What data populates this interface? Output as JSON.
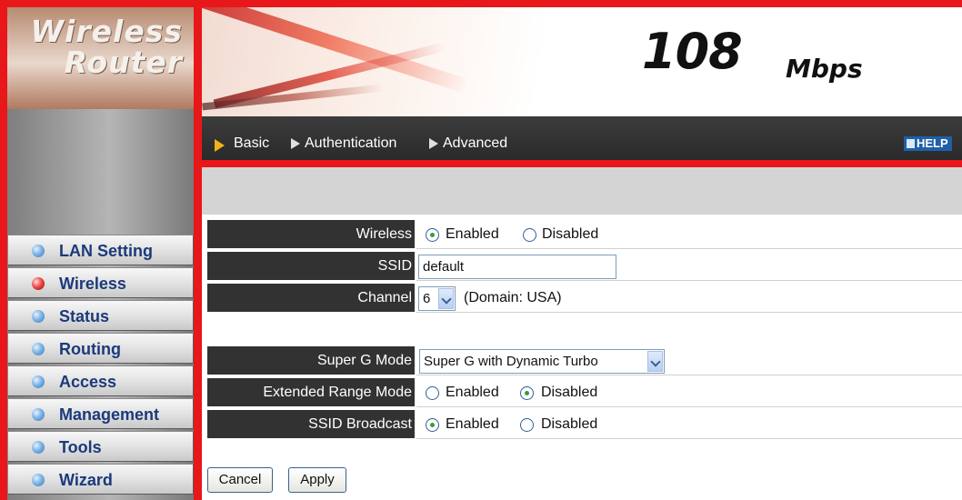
{
  "brand": {
    "logo_line1": "Wireless",
    "logo_line2": "Router",
    "speed_value": "108",
    "speed_unit": "Mbps"
  },
  "nav": {
    "basic": "Basic",
    "authentication": "Authentication",
    "advanced": "Advanced",
    "help": "HELP"
  },
  "sidebar": {
    "items": [
      {
        "label": "LAN Setting",
        "icon": "bullet-blue-icon",
        "active": false
      },
      {
        "label": "Wireless",
        "icon": "bullet-red-icon",
        "active": true
      },
      {
        "label": "Status",
        "icon": "bullet-blue-icon",
        "active": false
      },
      {
        "label": "Routing",
        "icon": "bullet-blue-icon",
        "active": false
      },
      {
        "label": "Access",
        "icon": "bullet-blue-icon",
        "active": false
      },
      {
        "label": "Management",
        "icon": "bullet-blue-icon",
        "active": false
      },
      {
        "label": "Tools",
        "icon": "bullet-blue-icon",
        "active": false
      },
      {
        "label": "Wizard",
        "icon": "bullet-blue-icon",
        "active": false
      }
    ]
  },
  "form": {
    "wireless": {
      "label": "Wireless",
      "opt_enabled": "Enabled",
      "opt_disabled": "Disabled",
      "selected": "Enabled"
    },
    "ssid": {
      "label": "SSID",
      "value": "default"
    },
    "channel": {
      "label": "Channel",
      "value": "6",
      "domain_text": "(Domain: USA)"
    },
    "super_g": {
      "label": "Super G Mode",
      "value": "Super G with Dynamic Turbo"
    },
    "extended_range": {
      "label": "Extended Range Mode",
      "opt_enabled": "Enabled",
      "opt_disabled": "Disabled",
      "selected": "Disabled"
    },
    "ssid_broadcast": {
      "label": "SSID Broadcast",
      "opt_enabled": "Enabled",
      "opt_disabled": "Disabled",
      "selected": "Enabled"
    }
  },
  "buttons": {
    "cancel": "Cancel",
    "apply": "Apply"
  },
  "colors": {
    "frame_red": "#e8171a",
    "label_bg": "#323232",
    "menu_text": "#1b3a7a",
    "help_bg": "#1f5fa8"
  }
}
